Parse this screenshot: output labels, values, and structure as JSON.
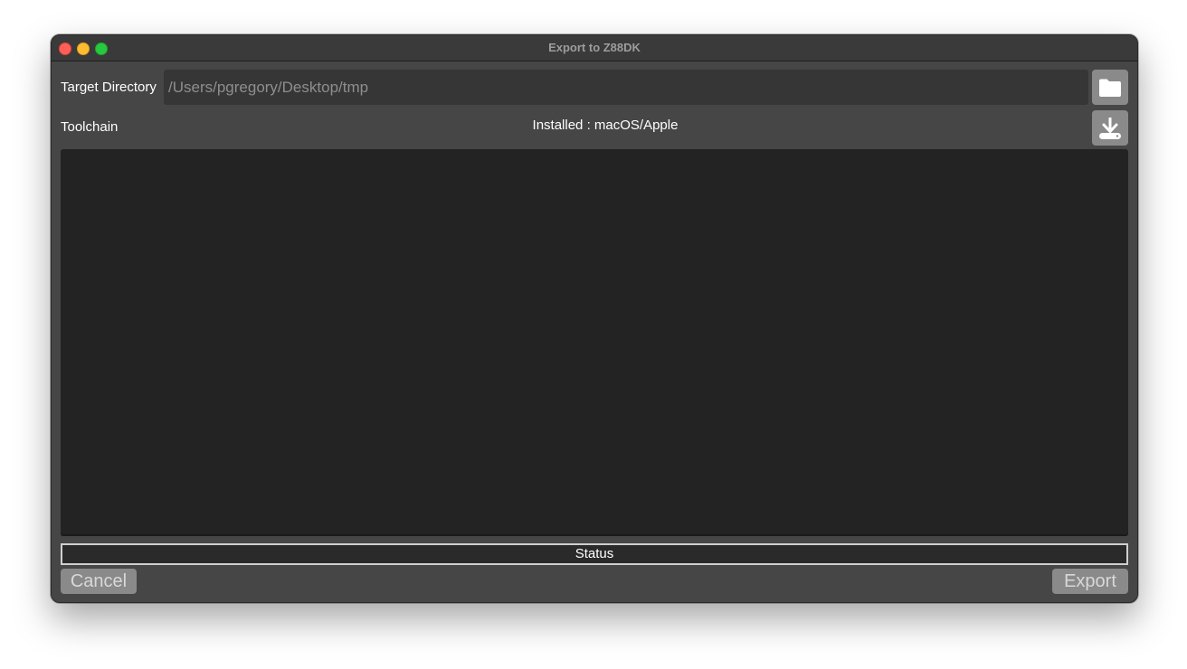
{
  "window": {
    "title": "Export to Z88DK"
  },
  "target_directory": {
    "label": "Target Directory",
    "value": "/Users/pgregory/Desktop/tmp",
    "browse_icon": "folder-icon"
  },
  "toolchain": {
    "label": "Toolchain",
    "installed_text": "Installed : macOS/Apple",
    "install_icon": "download-to-disk-icon"
  },
  "output_log": {
    "lines": []
  },
  "status": {
    "text": "Status"
  },
  "actions": {
    "cancel_label": "Cancel",
    "export_label": "Export"
  },
  "colors": {
    "window_bg": "#464646",
    "titlebar_bg": "#3a3a3a",
    "output_bg": "#232323",
    "button_bg": "#8a8a8a",
    "close": "#fe5f57",
    "minimize": "#febc2e",
    "maximize": "#28c840"
  }
}
